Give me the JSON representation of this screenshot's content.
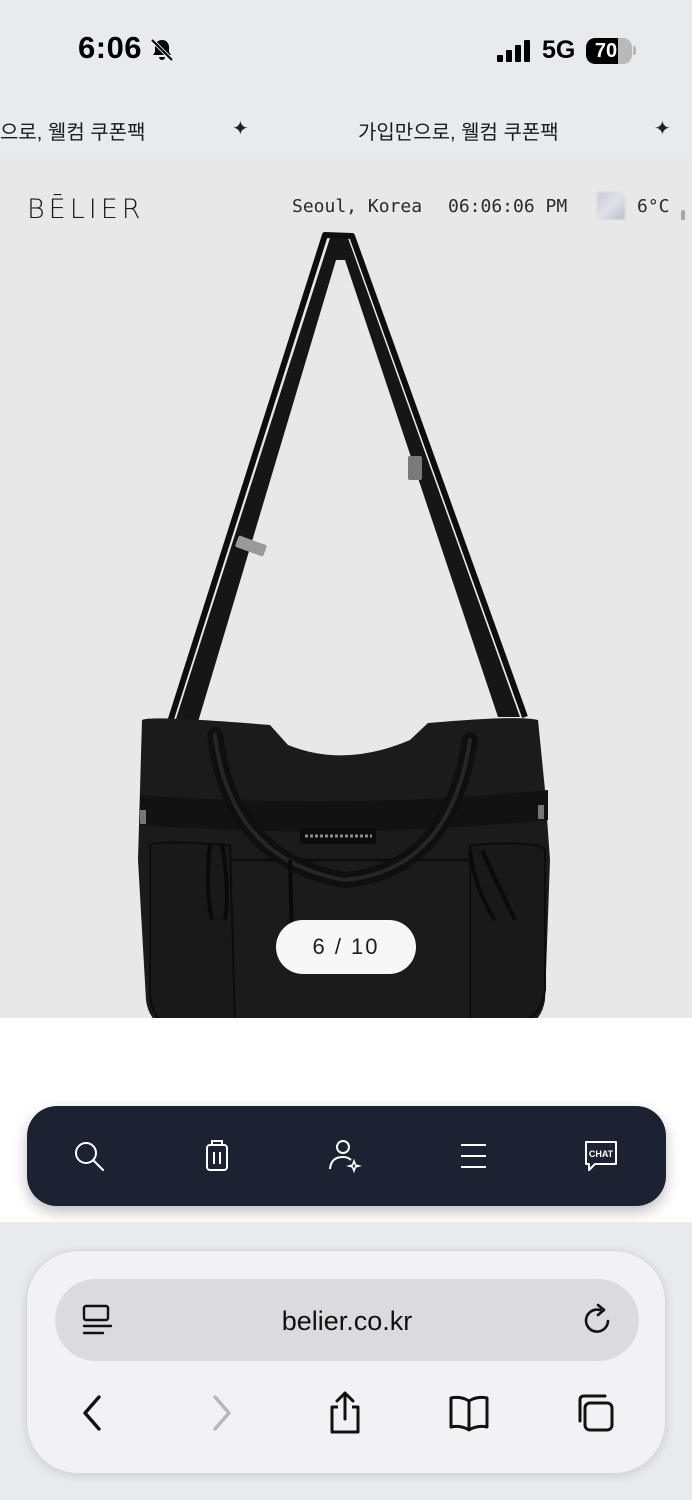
{
  "status_bar": {
    "time": "6:06",
    "network": "5G",
    "battery_level": "70",
    "battery_fraction": 0.7
  },
  "promo": {
    "text": "가입만으로, 웰컴 쿠폰팩",
    "text_partial": "으로, 웰컴 쿠폰팩"
  },
  "header": {
    "logo": "BĒLIER",
    "location": "Seoul, Korea",
    "clock": "06:06:06 PM",
    "temperature": "6°C"
  },
  "gallery": {
    "pager": "6 / 10"
  },
  "bottom_nav": {
    "items": [
      "search-icon",
      "shopping-bag-icon",
      "user-sparkle-icon",
      "menu-icon",
      "chat-icon"
    ],
    "chat_label": "CHAT"
  },
  "safari": {
    "url": "belier.co.kr"
  }
}
